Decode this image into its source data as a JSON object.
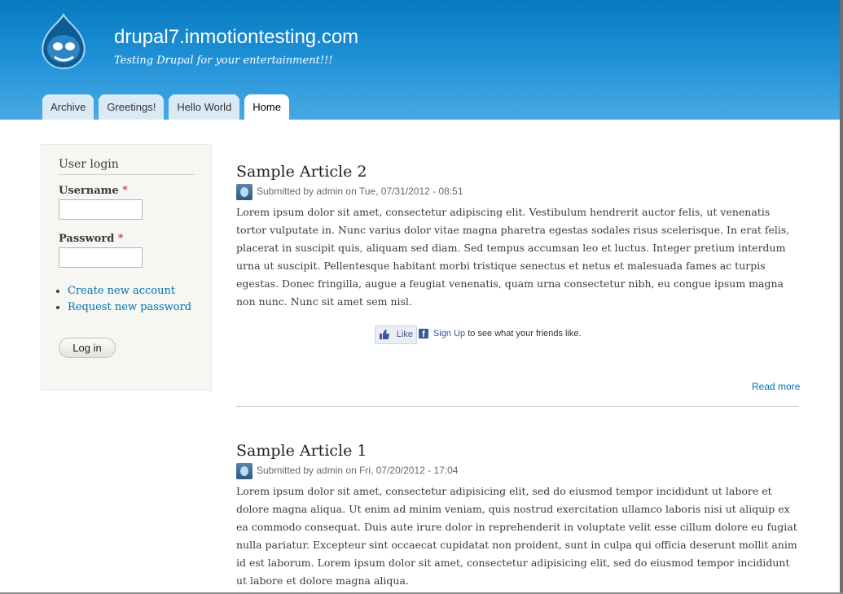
{
  "site": {
    "name": "drupal7.inmotiontesting.com",
    "slogan": "Testing Drupal for your entertainment!!!"
  },
  "tabs": [
    {
      "label": "Archive",
      "active": false
    },
    {
      "label": "Greetings!",
      "active": false
    },
    {
      "label": "Hello World",
      "active": false
    },
    {
      "label": "Home",
      "active": true
    }
  ],
  "login_block": {
    "title": "User login",
    "username_label": "Username",
    "password_label": "Password",
    "required_mark": "*",
    "username_value": "",
    "password_value": "",
    "links": [
      "Create new account",
      "Request new password"
    ],
    "submit_label": "Log in"
  },
  "articles": [
    {
      "title": "Sample Article 2",
      "meta": "Submitted by admin on Tue, 07/31/2012 - 08:51",
      "body": "Lorem ipsum dolor sit amet, consectetur adipiscing elit. Vestibulum hendrerit auctor felis, ut venenatis tortor vulputate in. Nunc varius dolor vitae magna pharetra egestas sodales risus scelerisque. In erat felis, placerat in suscipit quis, aliquam sed diam. Sed tempus accumsan leo et luctus. Integer pretium interdum urna ut suscipit. Pellentesque habitant morbi tristique senectus et netus et malesuada fames ac turpis egestas. Donec fringilla, augue a feugiat venenatis, quam urna consectetur nibh, eu congue ipsum magna non nunc. Nunc sit amet sem nisl."
    },
    {
      "title": "Sample Article 1",
      "meta": "Submitted by admin on Fri, 07/20/2012 - 17:04",
      "body": "Lorem ipsum dolor sit amet, consectetur adipisicing elit, sed do eiusmod tempor incididunt ut labore et dolore magna aliqua. Ut enim ad minim veniam, quis nostrud exercitation ullamco laboris nisi ut aliquip ex ea commodo consequat. Duis aute irure dolor in reprehenderit in voluptate velit esse cillum dolore eu fugiat nulla pariatur. Excepteur sint occaecat cupidatat non proident, sunt in culpa qui officia deserunt mollit anim id est laborum. Lorem ipsum dolor sit amet, consectetur adipisicing elit, sed do eiusmod tempor incididunt ut labore et dolore magna aliqua."
    }
  ],
  "facebook": {
    "like_label": "Like",
    "signup_label": "Sign Up",
    "signup_suffix": "to see what your friends like."
  },
  "read_more": "Read more",
  "colors": {
    "header_top": "#0779bf",
    "header_bottom": "#48a9e4",
    "link": "#0071b3",
    "sidebar_bg": "#f6f6f2"
  }
}
